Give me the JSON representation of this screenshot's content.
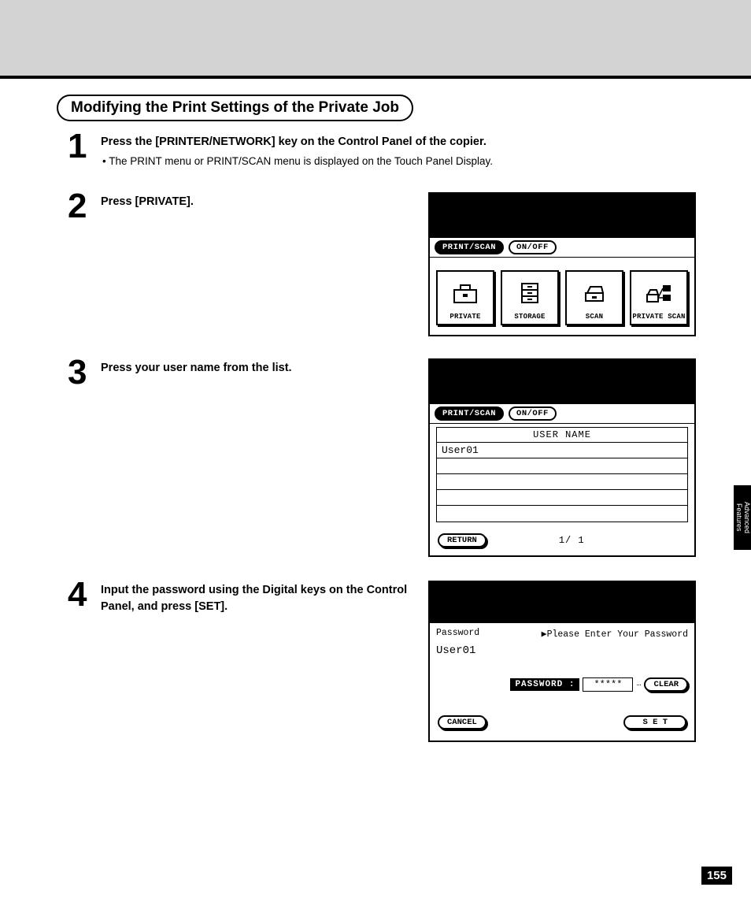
{
  "section_title": "Modifying the Print Settings of the Private Job",
  "steps": {
    "s1": {
      "num": "1",
      "bold": "Press the [PRINTER/NETWORK] key on the Control Panel of the copier.",
      "bullet": "• The PRINT menu or PRINT/SCAN menu is displayed on the Touch Panel Display."
    },
    "s2": {
      "num": "2",
      "bold": "Press [PRIVATE]."
    },
    "s3": {
      "num": "3",
      "bold": "Press your user name from the list."
    },
    "s4": {
      "num": "4",
      "bold": "Input the password using the Digital keys on the Control Panel, and press [SET]."
    }
  },
  "panel2": {
    "pill_a": "PRINT/SCAN",
    "pill_b": "ON/OFF",
    "icons": {
      "private": "PRIVATE",
      "storage": "STORAGE",
      "scan": "SCAN",
      "private_scan": "PRIVATE SCAN"
    }
  },
  "panel3": {
    "pill_a": "PRINT/SCAN",
    "pill_b": "ON/OFF",
    "hdr": "USER NAME",
    "user": "User01",
    "return": "RETURN",
    "page": "1/ 1"
  },
  "panel4": {
    "lbl_password": "Password",
    "prompt": "▶Please Enter Your Password",
    "user": "User01",
    "pw_label": "PASSWORD :",
    "pw_value": "*****",
    "dots": "…",
    "clear": "CLEAR",
    "cancel": "CANCEL",
    "set": "S E T"
  },
  "side_tab": "Advanced Features",
  "page_number": "155"
}
